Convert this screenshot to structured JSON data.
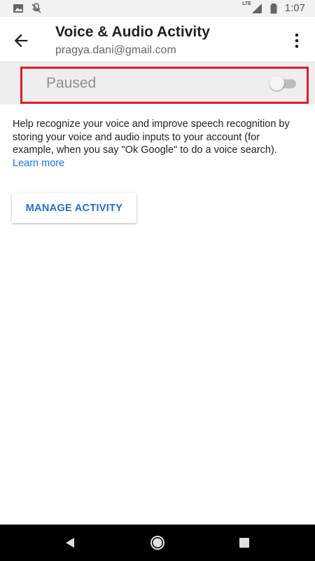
{
  "status_bar": {
    "time": "1:07",
    "network_label": "LTE",
    "icons": [
      "image-icon",
      "no-mic-icon",
      "signal-icon",
      "battery-icon"
    ]
  },
  "app_bar": {
    "title": "Voice & Audio Activity",
    "subtitle": "pragya.dani@gmail.com",
    "back_icon": "arrow-back-icon",
    "more_icon": "more-vert-icon"
  },
  "activity": {
    "status_label": "Paused",
    "toggle_on": false
  },
  "description": {
    "text": "Help recognize your voice and improve speech recognition by storing your voice and audio inputs to your account (for example, when you say \"Ok Google\" to do a voice search).",
    "link_text": "Learn more"
  },
  "manage_button": {
    "label": "MANAGE ACTIVITY"
  },
  "nav_bar": {
    "icons": [
      "nav-back-icon",
      "nav-home-icon",
      "nav-recents-icon"
    ]
  },
  "colors": {
    "accent": "#1a73e8",
    "highlight_border": "#e21c2c",
    "band_background": "#eeeeee"
  }
}
